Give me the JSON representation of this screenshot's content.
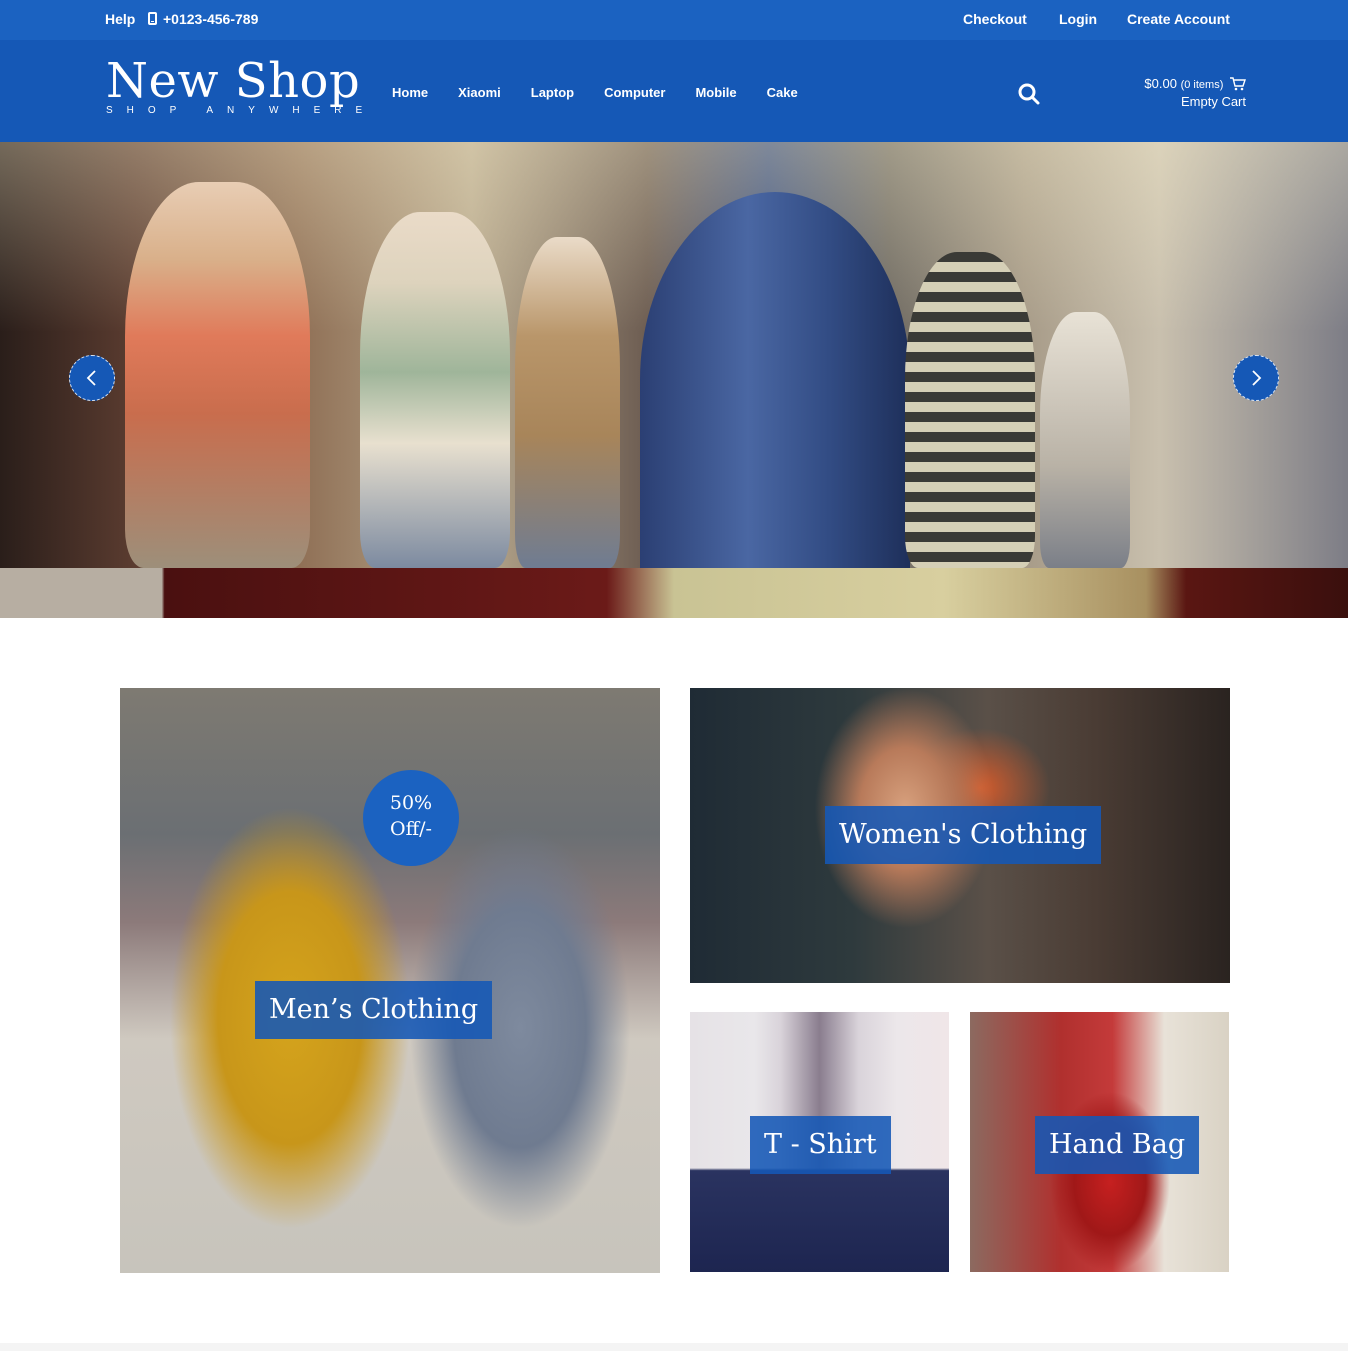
{
  "topbar": {
    "help": "Help",
    "phone": "+0123-456-789",
    "checkout": "Checkout",
    "login": "Login",
    "create_account": "Create Account"
  },
  "header": {
    "logo_title": "New Shop",
    "logo_tagline": "SHOP ANYWHERE",
    "nav": [
      "Home",
      "Xiaomi",
      "Laptop",
      "Computer",
      "Mobile",
      "Cake"
    ],
    "cart_total": "$0.00",
    "cart_items": "(0 items)",
    "cart_status": "Empty Cart"
  },
  "categories": {
    "men": {
      "label": "Men’s Clothing",
      "badge_line1": "50%",
      "badge_line2": "Off/-"
    },
    "women": {
      "label": "Women's Clothing"
    },
    "tshirt": {
      "label": "T - Shirt"
    },
    "handbag": {
      "label": "Hand Bag"
    }
  },
  "colors": {
    "topbar": "#1b62c1",
    "header": "#1558b6",
    "label_bg": "#1558b6"
  },
  "icons": [
    "phone-icon",
    "search-icon",
    "cart-icon",
    "chevron-left-icon",
    "chevron-right-icon"
  ]
}
